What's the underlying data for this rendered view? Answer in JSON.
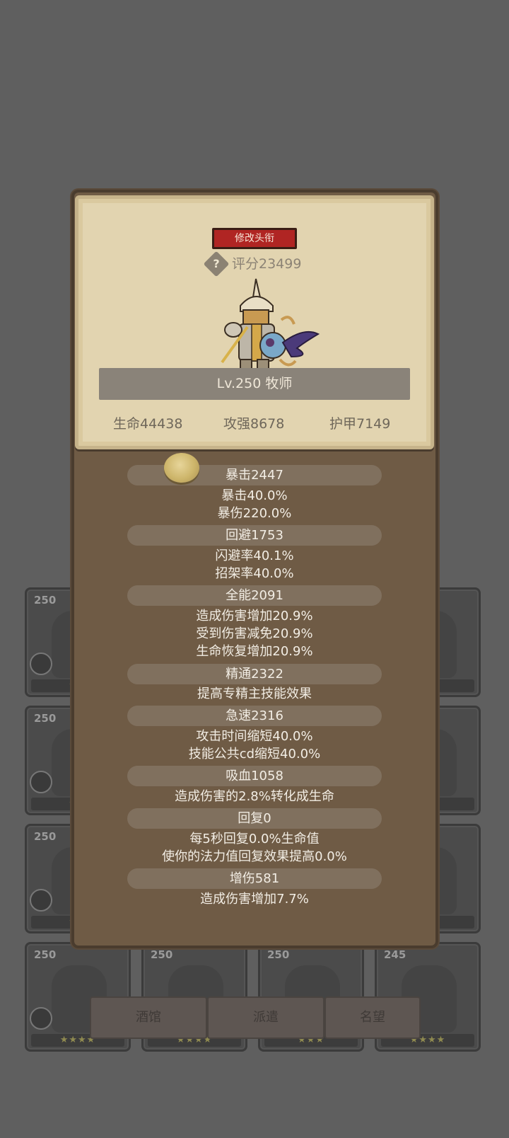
{
  "panel": {
    "title_button": "修改头衔",
    "help_icon": "question-diamond-icon",
    "score": "评分23499",
    "level_class": "Lv.250 牧师",
    "main_stats": [
      "生命44438",
      "攻强8678",
      "护甲7149"
    ]
  },
  "stats": [
    {
      "name": "暴击2447",
      "details": [
        "暴击40.0%",
        "暴伤220.0%"
      ]
    },
    {
      "name": "回避1753",
      "details": [
        "闪避率40.1%",
        "招架率40.0%"
      ]
    },
    {
      "name": "全能2091",
      "details": [
        "造成伤害增加20.9%",
        "受到伤害减免20.9%",
        "生命恢复增加20.9%"
      ]
    },
    {
      "name": "精通2322",
      "details": [
        "提高专精主技能效果"
      ]
    },
    {
      "name": "急速2316",
      "details": [
        "攻击时间缩短40.0%",
        "技能公共cd缩短40.0%"
      ]
    },
    {
      "name": "吸血1058",
      "details": [
        "造成伤害的2.8%转化成生命"
      ]
    },
    {
      "name": "回复0",
      "details": [
        "每5秒回复0.0%生命值",
        "使你的法力值回复效果提高0.0%"
      ]
    },
    {
      "name": "增伤581",
      "details": [
        "造成伤害增加7.7%"
      ]
    }
  ],
  "background": {
    "cards": [
      {
        "level": "250",
        "stars": "★★"
      },
      {
        "level": "250",
        "stars": "★★"
      },
      {
        "level": "250",
        "stars": "★★"
      },
      {
        "level": "250",
        "stars": "★★★★"
      },
      {
        "level": "250",
        "stars": "★★★★"
      },
      {
        "level": "250",
        "stars": "★★★"
      },
      {
        "level": "245",
        "stars": "★★★★"
      }
    ],
    "bottom_buttons": [
      "酒馆",
      "派遣",
      "名望"
    ]
  }
}
